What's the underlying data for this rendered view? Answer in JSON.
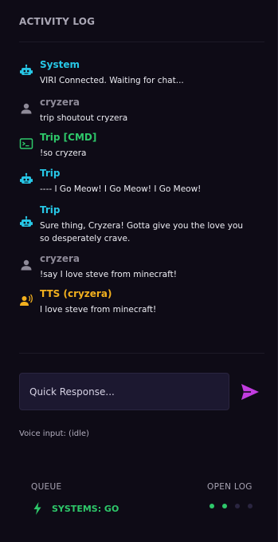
{
  "panel": {
    "title": "ACTIVITY LOG"
  },
  "log": [
    {
      "sender": "System",
      "message": "VIRI Connected. Waiting for chat...",
      "icon": "robot-icon",
      "color": "#27c7e6"
    },
    {
      "sender": "cryzera",
      "message": "trip shoutout cryzera",
      "icon": "user-icon",
      "color": "#8e8a98"
    },
    {
      "sender": "Trip [CMD]",
      "message": "!so cryzera",
      "icon": "terminal-icon",
      "color": "#2ec86a"
    },
    {
      "sender": "Trip",
      "message": "---- I Go Meow! I Go Meow! I Go Meow!",
      "icon": "robot-icon",
      "color": "#27c7e6"
    },
    {
      "sender": "Trip",
      "message": "Sure thing, Cryzera! Gotta give you the love you so desperately crave.",
      "icon": "robot-icon",
      "color": "#27c7e6"
    },
    {
      "sender": "cryzera",
      "message": "!say I love steve from minecraft!",
      "icon": "user-icon",
      "color": "#8e8a98"
    },
    {
      "sender": "TTS (cryzera)",
      "message": "I love steve from minecraft!",
      "icon": "speaker-voice-icon",
      "color": "#f2b01e"
    }
  ],
  "quick_response": {
    "placeholder": "Quick Response..."
  },
  "voice_input": "Voice input: (idle)",
  "footer": {
    "queue_label": "QUEUE",
    "open_log_label": "OPEN LOG",
    "status": "SYSTEMS: GO",
    "status_icon": "lightning-icon",
    "status_color": "#2ec86a"
  },
  "colors": {
    "accent": "#c23ce0",
    "background": "#0e0b16"
  }
}
